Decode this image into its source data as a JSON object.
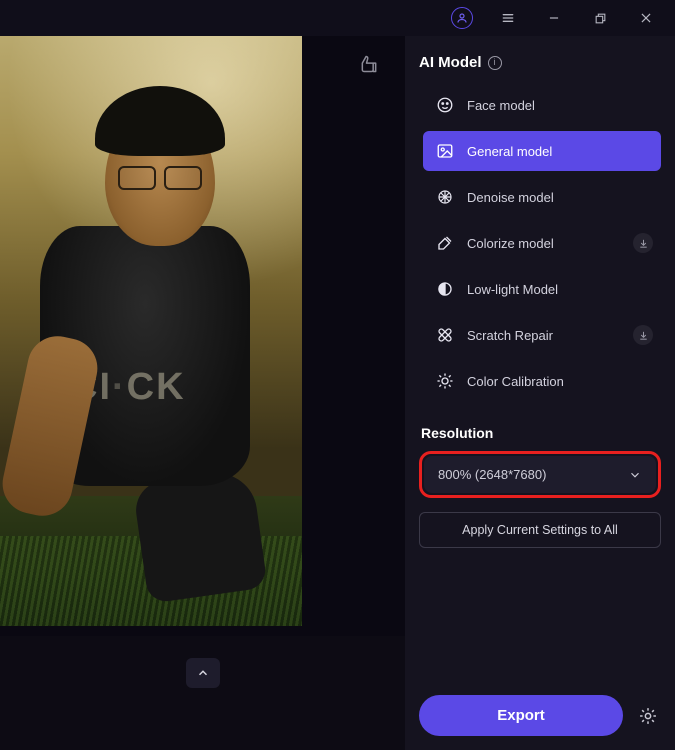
{
  "panel": {
    "title": "AI Model",
    "models": [
      {
        "label": "Face model"
      },
      {
        "label": "General model"
      },
      {
        "label": "Denoise model"
      },
      {
        "label": "Colorize model"
      },
      {
        "label": "Low-light Model"
      },
      {
        "label": "Scratch Repair"
      },
      {
        "label": "Color Calibration"
      }
    ],
    "resolution_title": "Resolution",
    "resolution_value": "800% (2648*7680)",
    "apply_label": "Apply Current Settings to All",
    "export_label": "Export"
  }
}
